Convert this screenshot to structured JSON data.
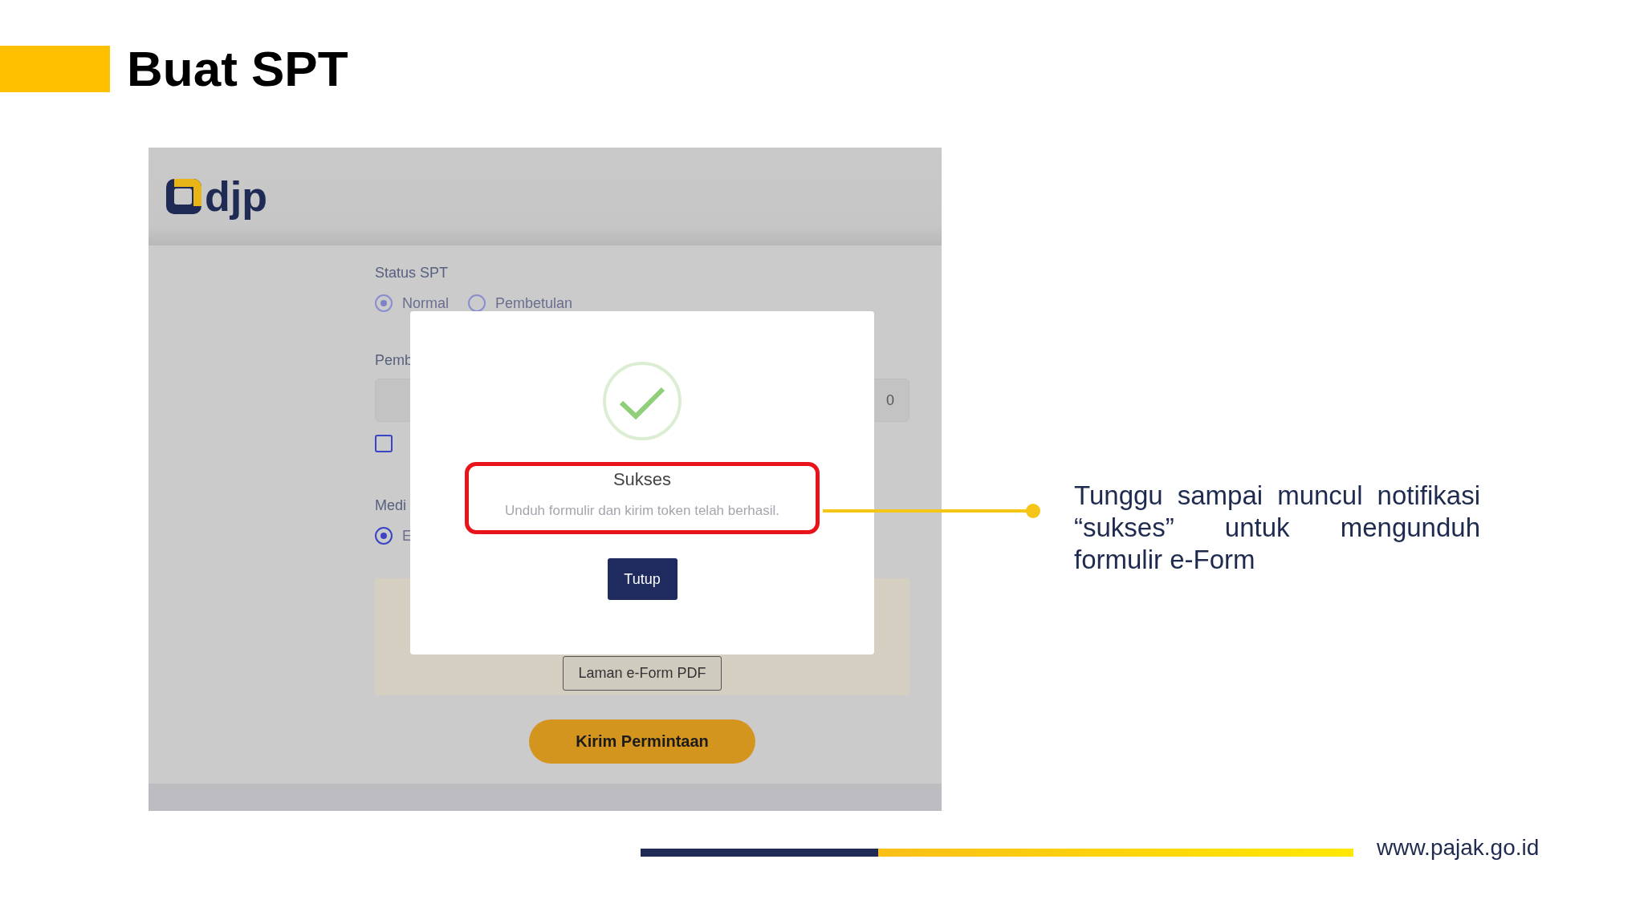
{
  "slide": {
    "title": "Buat SPT"
  },
  "screenshot": {
    "logo": "djp",
    "form": {
      "status_label": "Status SPT",
      "status_options": [
        {
          "label": "Normal",
          "selected": true
        },
        {
          "label": "Pembetulan",
          "selected": false
        }
      ],
      "field_label": "Pemb",
      "field_value": "0",
      "checkbox": {
        "checked": false
      },
      "media_label": "Medi",
      "media_options": [
        {
          "label": "E",
          "selected": true
        }
      ],
      "eform_button": "Laman e-Form PDF",
      "submit_button": "Kirim Permintaan"
    },
    "modal": {
      "title": "Sukses",
      "message": "Unduh formulir dan kirim token telah berhasil.",
      "close_button": "Tutup"
    }
  },
  "note": "Tunggu sampai muncul notifikasi “sukses” untuk mengunduh formulir e-Form",
  "footer": {
    "url": "www.pajak.go.id"
  }
}
